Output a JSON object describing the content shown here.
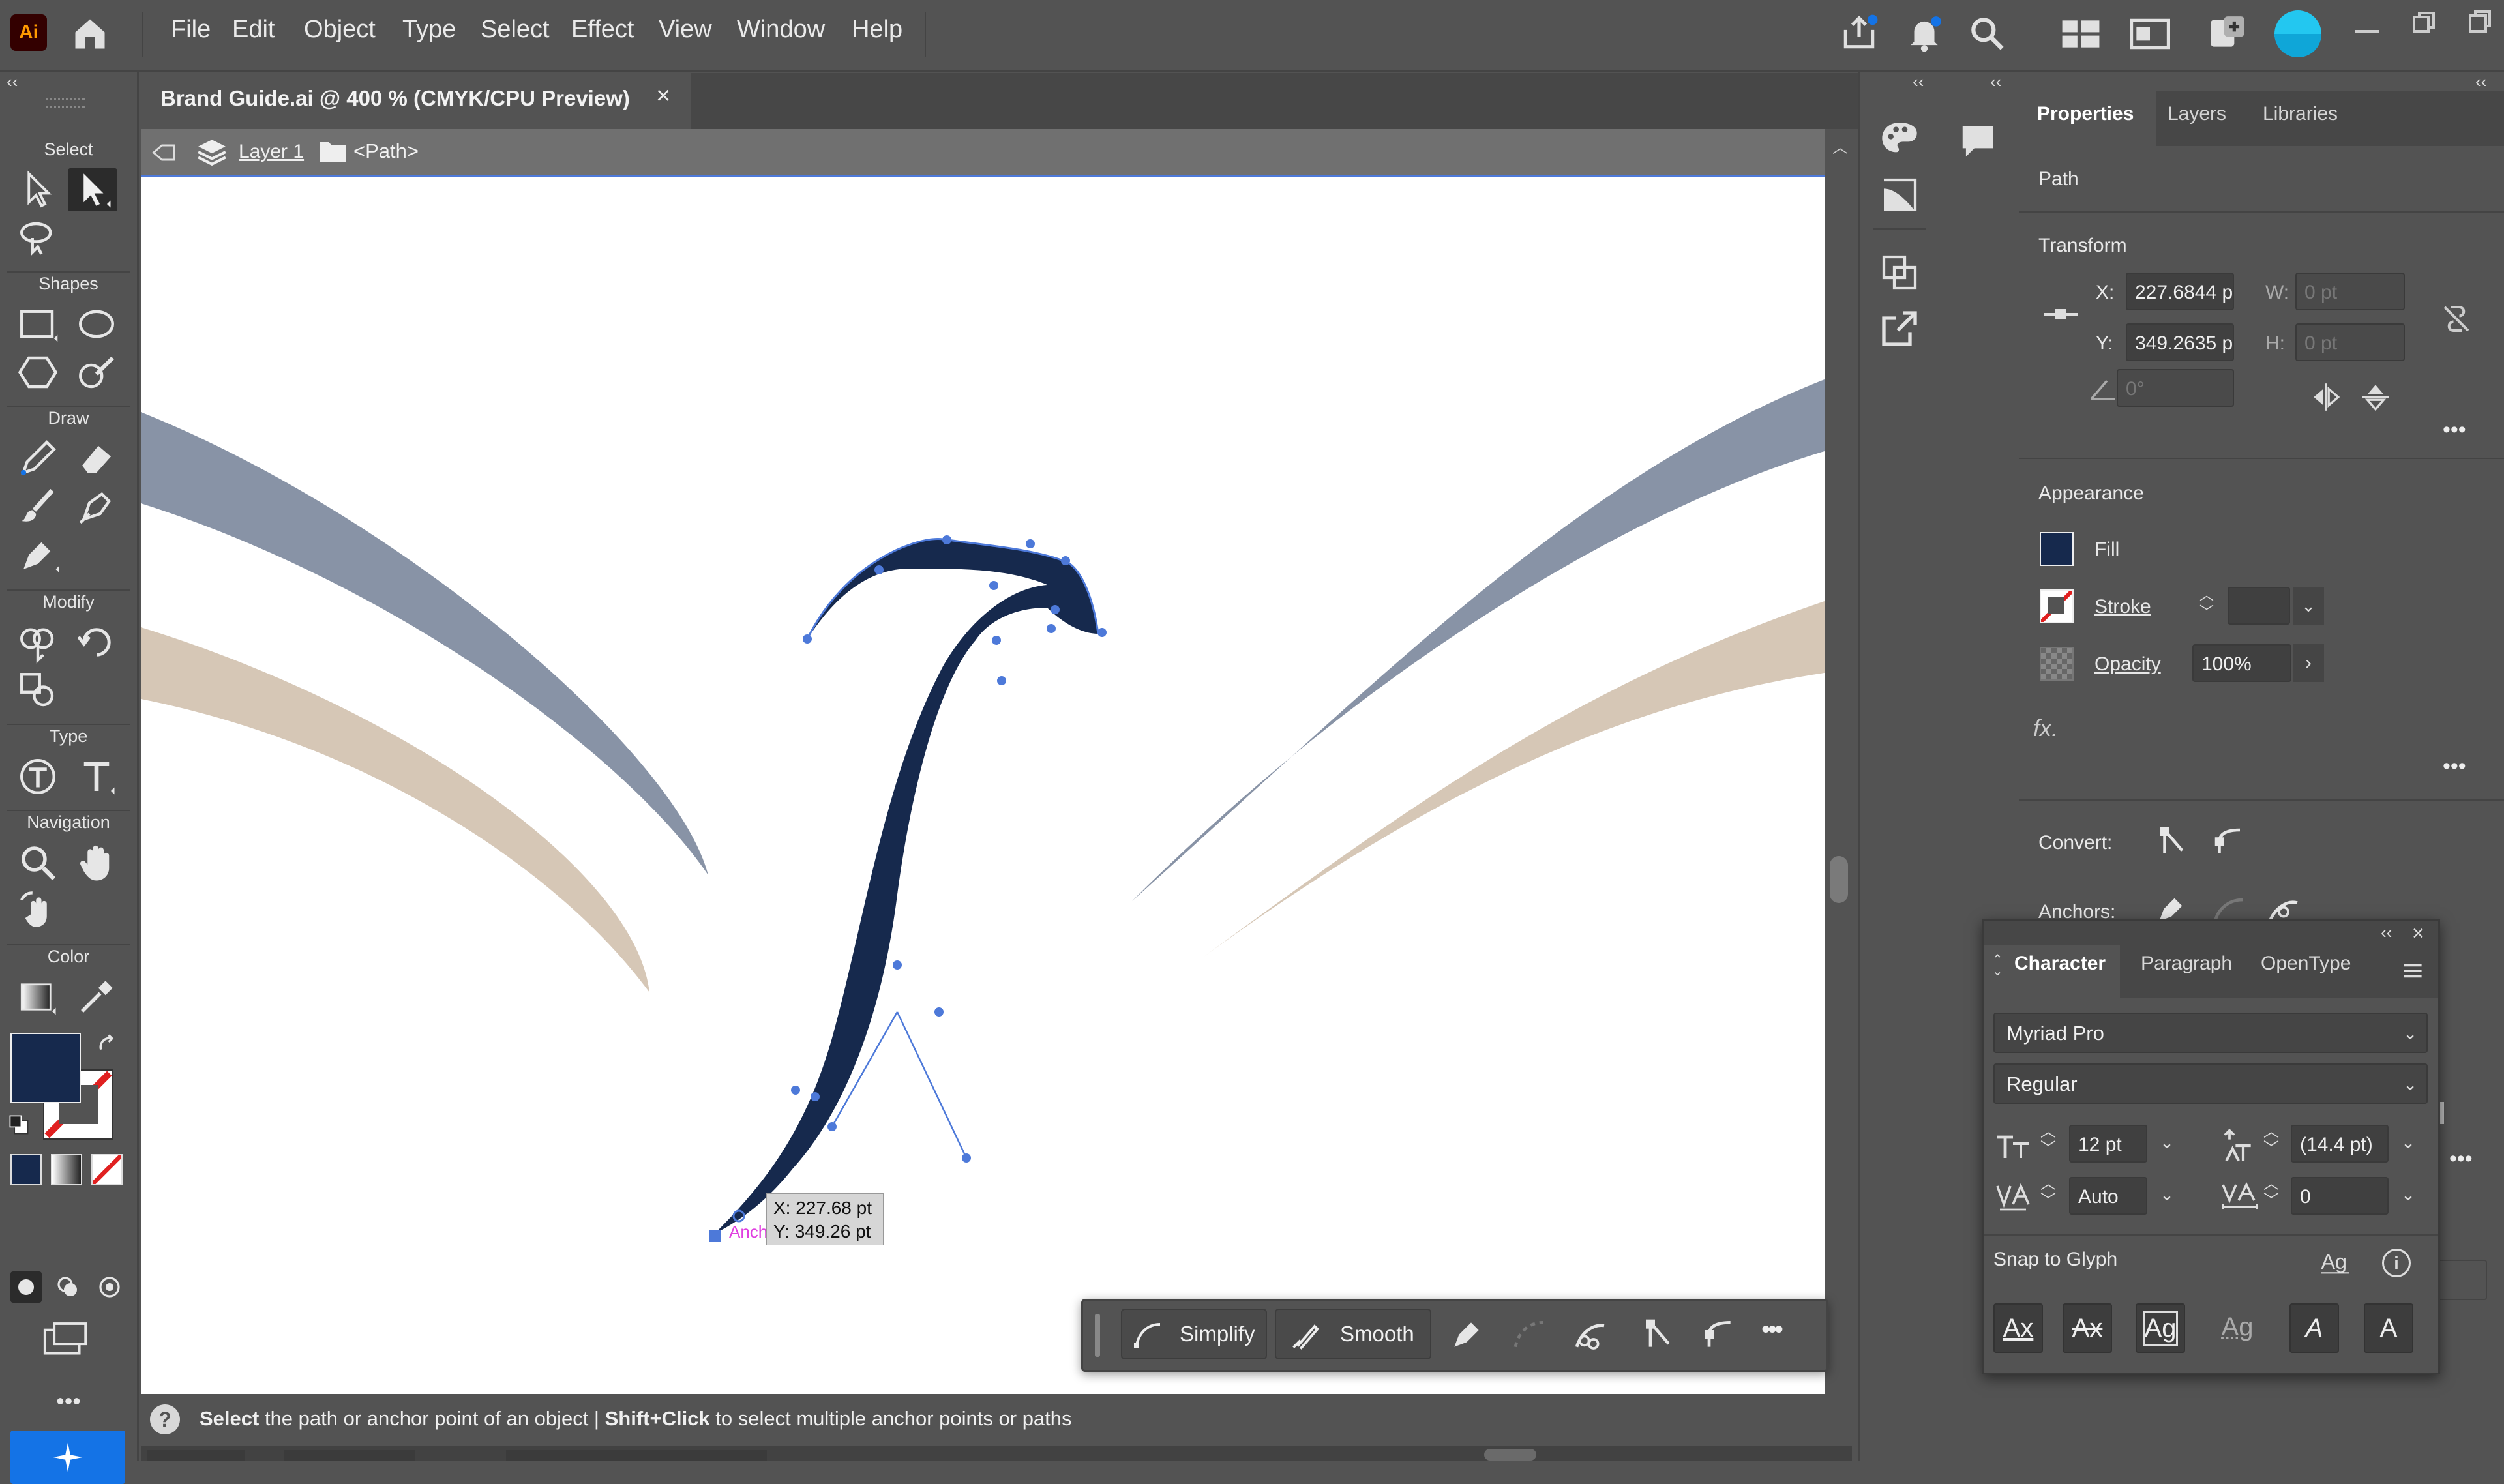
{
  "app": {
    "logo": "Ai",
    "menu": [
      "File",
      "Edit",
      "Object",
      "Type",
      "Select",
      "Effect",
      "View",
      "Window",
      "Help"
    ]
  },
  "document": {
    "tab_title": "Brand Guide.ai @ 400 % (CMYK/CPU Preview)",
    "close": "×"
  },
  "breadcrumb": {
    "layer": "Layer 1",
    "path": "<Path>"
  },
  "tools": {
    "sections": {
      "select": "Select",
      "shapes": "Shapes",
      "draw": "Draw",
      "modify": "Modify",
      "type": "Type",
      "navigation": "Navigation",
      "color": "Color"
    },
    "more": "•••"
  },
  "colors": {
    "fill": "#16294d",
    "stroke_none": "#e02020",
    "accent": "#1473e6",
    "curve_gray": "#8893a6",
    "curve_tan": "#d6c7b6",
    "selection": "#4d79d9"
  },
  "canvas": {
    "anchor_label": "Anchor",
    "tooltip_x": "X: 227.68 pt",
    "tooltip_y": "Y: 349.26 pt"
  },
  "context_bar": {
    "simplify": "Simplify",
    "smooth": "Smooth",
    "more": "•••"
  },
  "status": {
    "text_bold1": "Select",
    "text1": " the path or anchor point of an object  |  ",
    "text_bold2": "Shift+Click",
    "text2": " to select multiple anchor points or paths"
  },
  "properties": {
    "tabs": [
      "Properties",
      "Layers",
      "Libraries"
    ],
    "object_type": "Path",
    "transform": {
      "title": "Transform",
      "x_label": "X:",
      "x_value": "227.6844 p",
      "y_label": "Y:",
      "y_value": "349.2635 p",
      "w_label": "W:",
      "w_value": "0 pt",
      "h_label": "H:",
      "h_value": "0 pt",
      "angle_value": "0°"
    },
    "appearance": {
      "title": "Appearance",
      "fill": "Fill",
      "stroke": "Stroke",
      "opacity": "Opacity",
      "opacity_value": "100%",
      "fx": "fx."
    },
    "convert": "Convert:",
    "anchors": "Anchors:",
    "more": "•••"
  },
  "character": {
    "tabs": [
      "Character",
      "Paragraph",
      "OpenType"
    ],
    "font_family": "Myriad Pro",
    "font_style": "Regular",
    "size": "12 pt",
    "leading": "(14.4 pt)",
    "kerning": "Auto",
    "tracking": "0",
    "snap_to_glyph": "Snap to Glyph",
    "glyphs": [
      "Ax",
      "Ax",
      "Ag",
      "Ag",
      "A",
      "A"
    ]
  }
}
